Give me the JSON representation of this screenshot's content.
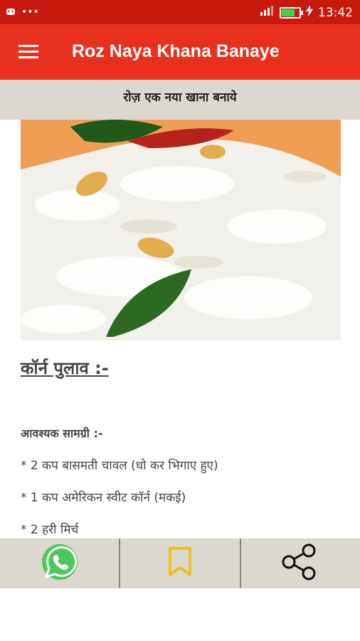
{
  "status_bar": {
    "notification_icons": [
      "android-icon",
      "more-icon"
    ],
    "network": "4G",
    "time": "13:42"
  },
  "app_bar": {
    "title": "Roz Naya Khana Banaye"
  },
  "tagline": "रोज़ एक नया खाना बनाये",
  "recipe": {
    "title": "कॉर्न पुलाव :-",
    "ingredients_heading": "आवश्यक सामग्री :-",
    "ingredients": [
      "* 2 कप बासमती चावल (धो कर भिगाए हुए)",
      "* 1 कप अमेरिकन स्वीट कॉर्न (मकई)",
      "* 2 हरी मिर्च"
    ]
  },
  "bottom_bar": {
    "actions": [
      "whatsapp-share",
      "bookmark",
      "share"
    ]
  },
  "colors": {
    "status_bar": "#c81a0e",
    "app_bar": "#e8311d",
    "bottom_bar": "#dcd7cf",
    "whatsapp": "#4bc95a",
    "bookmark": "#ecc10a"
  }
}
